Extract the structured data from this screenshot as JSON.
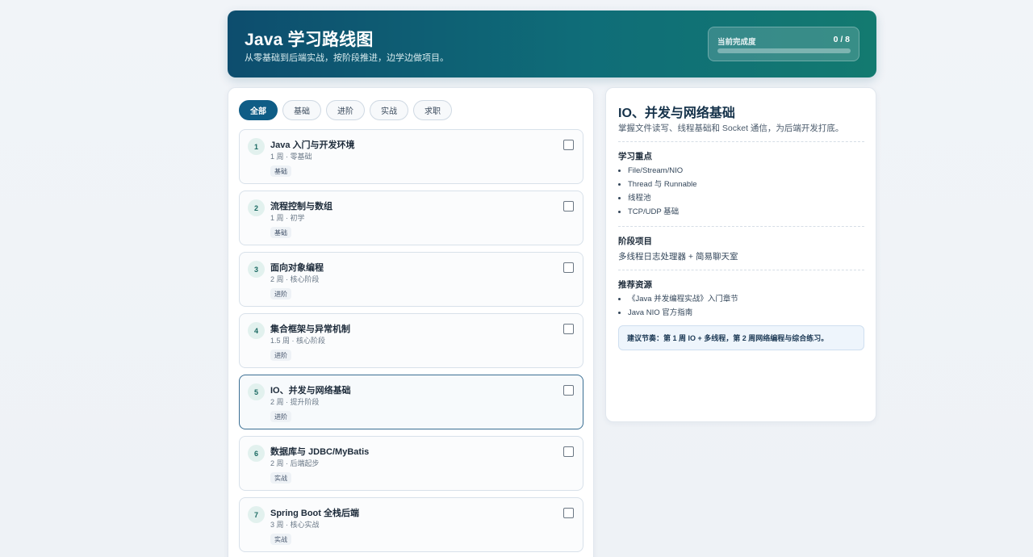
{
  "header": {
    "title": "Java 学习路线图",
    "subtitle": "从零基础到后端实战，按阶段推进，边学边做项目。",
    "progress_label": "当前完成度",
    "progress_count": "0 / 8",
    "progress_fraction": 0
  },
  "filters": [
    "全部",
    "基础",
    "进阶",
    "实战",
    "求职"
  ],
  "active_filter": "全部",
  "roadmap": [
    {
      "num": "1",
      "title": "Java 入门与开发环境",
      "meta": "1 周 · 零基础",
      "tag": "基础"
    },
    {
      "num": "2",
      "title": "流程控制与数组",
      "meta": "1 周 · 初学",
      "tag": "基础"
    },
    {
      "num": "3",
      "title": "面向对象编程",
      "meta": "2 周 · 核心阶段",
      "tag": "进阶"
    },
    {
      "num": "4",
      "title": "集合框架与异常机制",
      "meta": "1.5 周 · 核心阶段",
      "tag": "进阶"
    },
    {
      "num": "5",
      "title": "IO、并发与网络基础",
      "meta": "2 周 · 提升阶段",
      "tag": "进阶"
    },
    {
      "num": "6",
      "title": "数据库与 JDBC/MyBatis",
      "meta": "2 周 · 后端起步",
      "tag": "实战"
    },
    {
      "num": "7",
      "title": "Spring Boot 全栈后端",
      "meta": "3 周 · 核心实战",
      "tag": "实战"
    }
  ],
  "detail": {
    "title": "IO、并发与网络基础",
    "description": "掌握文件读写、线程基础和 Socket 通信，为后端开发打底。",
    "focus_title": "学习重点",
    "focus_items": [
      "File/Stream/NIO",
      "Thread 与 Runnable",
      "线程池",
      "TCP/UDP 基础"
    ],
    "project_title": "阶段项目",
    "project_text": "多线程日志处理器 + 简易聊天室",
    "resources_title": "推荐资源",
    "resources": [
      "《Java 并发编程实战》入门章节",
      "Java NIO 官方指南"
    ],
    "tip": "建议节奏：第 1 周 IO + 多线程，第 2 周网络编程与综合练习。"
  }
}
